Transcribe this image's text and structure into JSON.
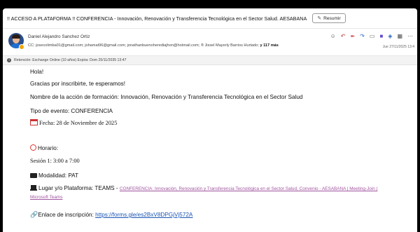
{
  "email": {
    "subject": "!! ACCESO A PLATAFORMA !! CONFERENCIA - Innovación, Renovación y Transferencia Tecnológica en el Sector Salud. AESABANA",
    "summarize_label": "Resumir",
    "sender": "Daniel Alejandro Sanchez Ortiz",
    "cc_text": "CC: josecolimba01@gmail.com; johamat96@gmail.com; jonathanbuenoherediajhon@hotmail.com; ® Jissel Mayerly Barrios Hurtado;",
    "cc_more": "y 117 más",
    "date": "Jue 27/11/2025 13:4",
    "retention": "Retención: Exchange Online (10 años) Expira: Dom 25/11/2035 13:47"
  },
  "body": {
    "greeting": "Hola!",
    "thanks": "Gracias por inscribirte, te esperamos!",
    "name_line": "Nombre de la acción de formación: Innovación, Renovación y Transferencia Tecnológica en el Sector Salud",
    "type_line": "Tipo de evento: CONFERENCIA",
    "date_line": "Fecha:   28 de Noviembre de 2025",
    "schedule_label": "Horario:",
    "session": "Sesión 1: 3:00 a 7:00",
    "modality": "Modalidad: PAT",
    "place_label": "Lugar y/o Plataforma: TEAMS  - ",
    "place_link": "CONFERENCIA: Innovación, Renovación y Transferencia Tecnológica en el Sector Salud, Convenio - AESABANA | Meeting-Join |",
    "place_link2": "Microsoft Teams",
    "signup_label": "Enlace de inscripción: ",
    "signup_link": "https://forms.gle/es2BxV8DPGjVj572A"
  }
}
